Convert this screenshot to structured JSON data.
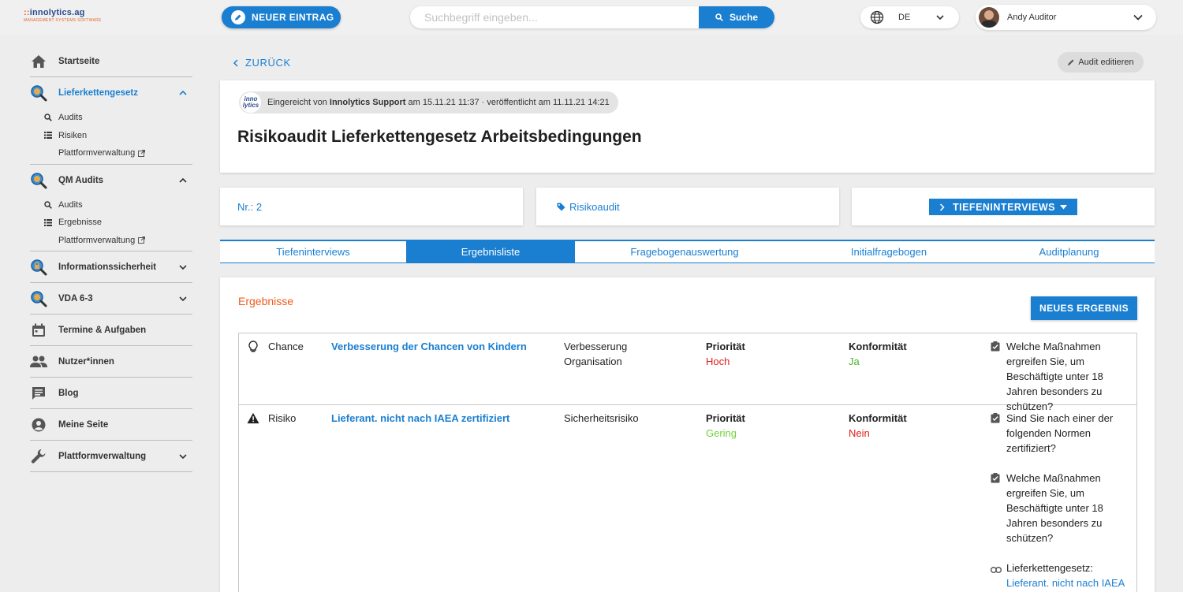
{
  "brand": {
    "name_a": "innolytics",
    "name_b": ".ag",
    "tagline": "MANAGEMENT SYSTEMS SOFTWARE"
  },
  "header": {
    "new_entry_label": "NEUER EINTRAG",
    "search_placeholder": "Suchbegriff eingeben...",
    "search_button": "Suche",
    "language": "DE",
    "user_name": "Andy Auditor"
  },
  "sidebar": {
    "items": [
      {
        "label": "Startseite"
      },
      {
        "label": "Lieferkettengesetz",
        "subs": [
          "Audits",
          "Risiken",
          "Plattformverwaltung"
        ]
      },
      {
        "label": "QM Audits",
        "subs": [
          "Audits",
          "Ergebnisse",
          "Plattformverwaltung"
        ]
      },
      {
        "label": "Informationssicherheit"
      },
      {
        "label": "VDA 6-3"
      },
      {
        "label": "Termine & Aufgaben"
      },
      {
        "label": "Nutzer*innen"
      },
      {
        "label": "Blog"
      },
      {
        "label": "Meine Seite"
      },
      {
        "label": "Plattformverwaltung"
      }
    ]
  },
  "page": {
    "back_label": "ZURÜCK",
    "edit_label": "Audit editieren",
    "submit_prefix": "Eingereicht von",
    "submit_author": "Innolytics Support",
    "submit_suffix": "am 15.11.21 11:37 · veröffentlicht am 11.11.21 14:21",
    "mini_logo_top": "inno",
    "mini_logo_bottom": "lytics",
    "title": "Risikoaudit Lieferkettengesetz Arbeitsbedingungen",
    "number": "Nr.: 2",
    "tag": "Risikoaudit",
    "tiefen_button": "TIEFENINTERVIEWS"
  },
  "tabs": [
    "Tiefeninterviews",
    "Ergebnisliste",
    "Fragebogenauswertung",
    "Initialfragebogen",
    "Auditplanung"
  ],
  "results": {
    "heading": "Ergebnisse",
    "new_button": "NEUES ERGEBNIS",
    "prio_label": "Priorität",
    "konf_label": "Konformität",
    "rows": [
      {
        "type": "Chance",
        "title": "Verbesserung der Chancen von Kindern",
        "category": "Verbesserung Organisation",
        "priority": "Hoch",
        "conformity": "Ja",
        "question": "Welche Maßnahmen ergreifen Sie, um Beschäftigte unter 18 Jahren besonders zu schützen?"
      },
      {
        "type": "Risiko",
        "title": "Lieferant. nicht nach IAEA zertifiziert",
        "category": "Sicherheitsrisiko",
        "priority": "Gering",
        "conformity": "Nein",
        "question1": "Sind Sie nach einer der folgenden Normen zertifiziert?",
        "question2": "Welche Maßnahmen ergreifen Sie, um Beschäftigte unter 18 Jahren besonders zu schützen?",
        "link_label": "Lieferkettengesetz:",
        "link_text": "Lieferant. nicht nach IAEA zertifiziert"
      }
    ]
  },
  "colors": {
    "accent": "#1a7fd1",
    "orange": "#f05a1a",
    "red": "#e02020",
    "green": "#4caf2a"
  }
}
